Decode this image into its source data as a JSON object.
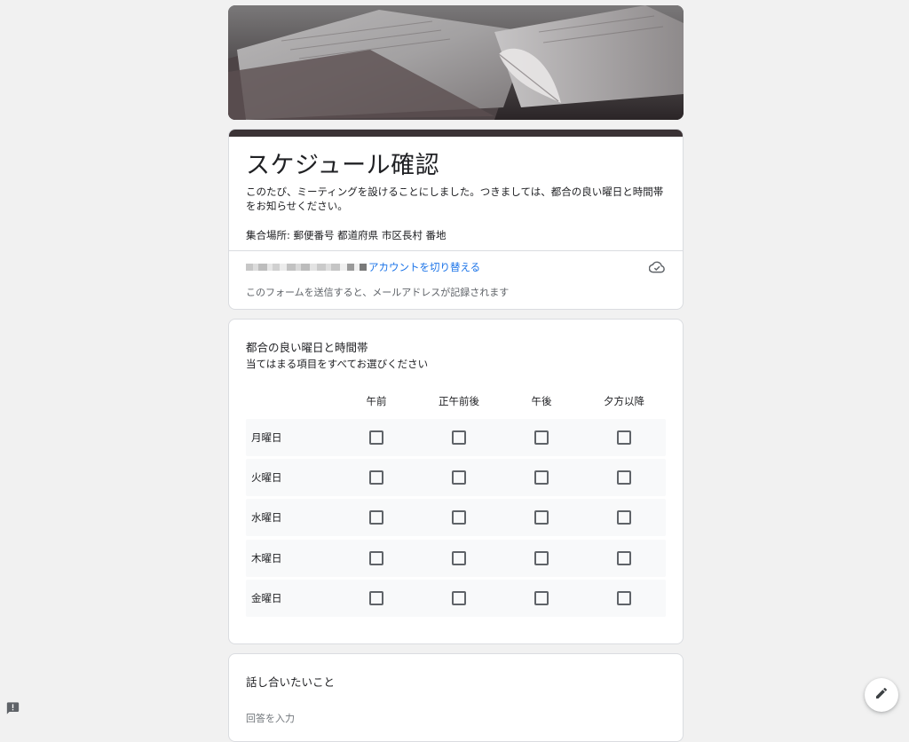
{
  "header": {
    "banner_alt": "open book with feather"
  },
  "form": {
    "title": "スケジュール確認",
    "description": "このたび、ミーティングを設けることにしました。つきましては、都合の良い曜日と時間帯をお知らせください。",
    "place": "集合場所: 郵便番号 都道府県 市区長村 番地",
    "switch_account": "アカウントを切り替える",
    "email_note": "このフォームを送信すると、メールアドレスが記録されます"
  },
  "grid_question": {
    "title": "都合の良い曜日と時間帯",
    "help": "当てはまる項目をすべてお選びください",
    "columns": [
      "午前",
      "正午前後",
      "午後",
      "夕方以降"
    ],
    "rows": [
      "月曜日",
      "火曜日",
      "水曜日",
      "木曜日",
      "金曜日"
    ]
  },
  "text_question": {
    "title": "話し合いたいこと",
    "placeholder": "回答を入力"
  },
  "icons": {
    "cloud": "cloud-check-icon",
    "edit": "pencil-icon",
    "report": "report-problem-icon"
  },
  "colors": {
    "accent": "#1a73e8",
    "theme_bar": "#3b3335",
    "background": "#f1f1f1"
  }
}
